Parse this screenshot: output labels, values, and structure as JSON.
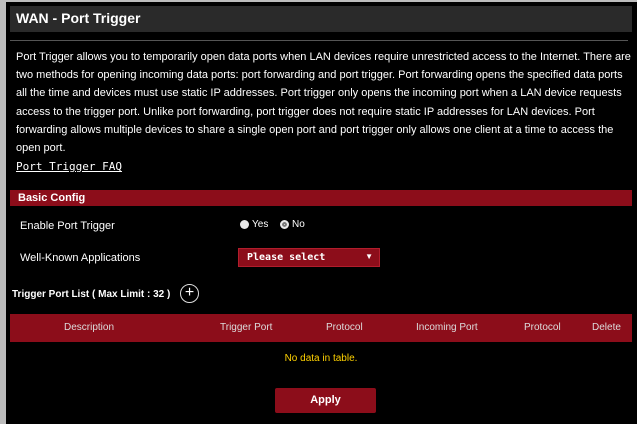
{
  "page": {
    "title": "WAN - Port Trigger",
    "description": "Port Trigger allows you to temporarily open data ports when LAN devices require unrestricted access to the Internet. There are two methods for opening incoming data ports: port forwarding and port trigger. Port forwarding opens the specified data ports all the time and devices must use static IP addresses. Port trigger only opens the incoming port when a LAN device requests access to the trigger port. Unlike port forwarding, port trigger does not require static IP addresses for LAN devices. Port forwarding allows multiple devices to share a single open port and port trigger only allows one client at a time to access the open port.",
    "faq_link": "Port Trigger FAQ"
  },
  "basic_config": {
    "section_title": "Basic Config",
    "enable_label": "Enable Port Trigger",
    "yes_label": "Yes",
    "no_label": "No",
    "selected": "No",
    "well_known_label": "Well-Known Applications",
    "well_known_value": "Please select"
  },
  "trigger_list": {
    "label": "Trigger Port List ( Max Limit : 32 )",
    "columns": [
      "Description",
      "Trigger Port",
      "Protocol",
      "Incoming Port",
      "Protocol",
      "Delete"
    ],
    "empty_text": "No data in table."
  },
  "actions": {
    "apply_label": "Apply"
  },
  "colors": {
    "accent": "#8c0d1a",
    "background": "#000000",
    "empty_text": "#ffd200"
  }
}
